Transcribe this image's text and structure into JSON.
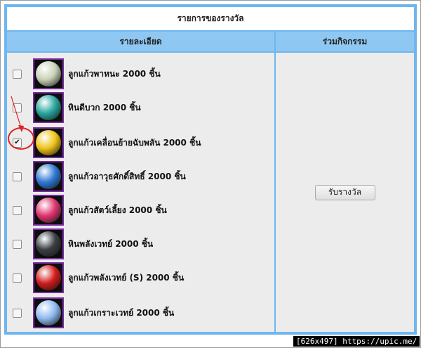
{
  "title": "รายการของรางวัล",
  "columns": {
    "details": "รายละเอียด",
    "activity": "ร่วมกิจกรรม"
  },
  "items": [
    {
      "label": "ลูกแก้วพาหนะ 2000 ชิ้น",
      "checked": false,
      "icon": "pearl-orb-icon",
      "color": "#c9d2b8"
    },
    {
      "label": "หินดีบวก 2000 ชิ้น",
      "checked": false,
      "icon": "teal-stone-icon",
      "color": "#2aa7a0"
    },
    {
      "label": "ลูกแก้วเคลื่อนย้ายฉับพลัน 2000 ชิ้น",
      "checked": true,
      "icon": "gold-orb-icon",
      "color": "#f0c419"
    },
    {
      "label": "ลูกแก้วอาวุธศักดิ์สิทธิ์ 2000 ชิ้น",
      "checked": false,
      "icon": "blue-orb-icon",
      "color": "#2f79d4"
    },
    {
      "label": "ลูกแก้วสัตว์เลี้ยง 2000 ชิ้น",
      "checked": false,
      "icon": "pink-gem-icon",
      "color": "#e0346e"
    },
    {
      "label": "หินพลังเวทย์ 2000 ชิ้น",
      "checked": false,
      "icon": "dark-stone-icon",
      "color": "#3b3f44"
    },
    {
      "label": "ลูกแก้วพลังเวทย์ (S) 2000 ชิ้น",
      "checked": false,
      "icon": "red-orb-icon",
      "color": "#d21c1c"
    },
    {
      "label": "ลูกแก้วเกราะเวทย์ 2000 ชิ้น",
      "checked": false,
      "icon": "ice-orb-icon",
      "color": "#8fb9f0"
    }
  ],
  "claim_button": "รับรางวัล",
  "watermark": "[626x497] https://upic.me/"
}
